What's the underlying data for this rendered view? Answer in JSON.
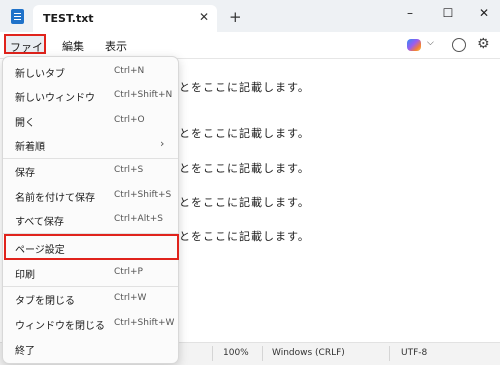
{
  "tab": {
    "title": "TEST.txt",
    "close": "✕",
    "new_tab": "+"
  },
  "window": {
    "minimize": "–",
    "maximize": "☐",
    "close": "✕"
  },
  "menubar": {
    "file": "ファイル",
    "edit": "編集",
    "view": "表示",
    "chevron": "⌵",
    "gear": "⚙"
  },
  "editor": {
    "lines": [
      "とをここに記載します。",
      "とをここに記載します。",
      "とをここに記載します。",
      "とをここに記載します。",
      "とをここに記載します。"
    ]
  },
  "statusbar": {
    "zoom": "100%",
    "line_ending": "Windows (CRLF)",
    "encoding": "UTF-8"
  },
  "file_menu": {
    "items": [
      {
        "label": "新しいタブ",
        "shortcut": "Ctrl+N"
      },
      {
        "label": "新しいウィンドウ",
        "shortcut": "Ctrl+Shift+N"
      },
      {
        "label": "開く",
        "shortcut": "Ctrl+O"
      },
      {
        "label": "新着順",
        "shortcut": "",
        "arrow": "›"
      },
      {
        "label": "保存",
        "shortcut": "Ctrl+S"
      },
      {
        "label": "名前を付けて保存",
        "shortcut": "Ctrl+Shift+S"
      },
      {
        "label": "すべて保存",
        "shortcut": "Ctrl+Alt+S"
      },
      {
        "label": "ページ設定",
        "shortcut": ""
      },
      {
        "label": "印刷",
        "shortcut": "Ctrl+P"
      },
      {
        "label": "タブを閉じる",
        "shortcut": "Ctrl+W"
      },
      {
        "label": "ウィンドウを閉じる",
        "shortcut": "Ctrl+Shift+W"
      },
      {
        "label": "終了",
        "shortcut": ""
      }
    ]
  },
  "colors": {
    "highlight": "#e0231c",
    "app_icon": "#1f72c9"
  }
}
